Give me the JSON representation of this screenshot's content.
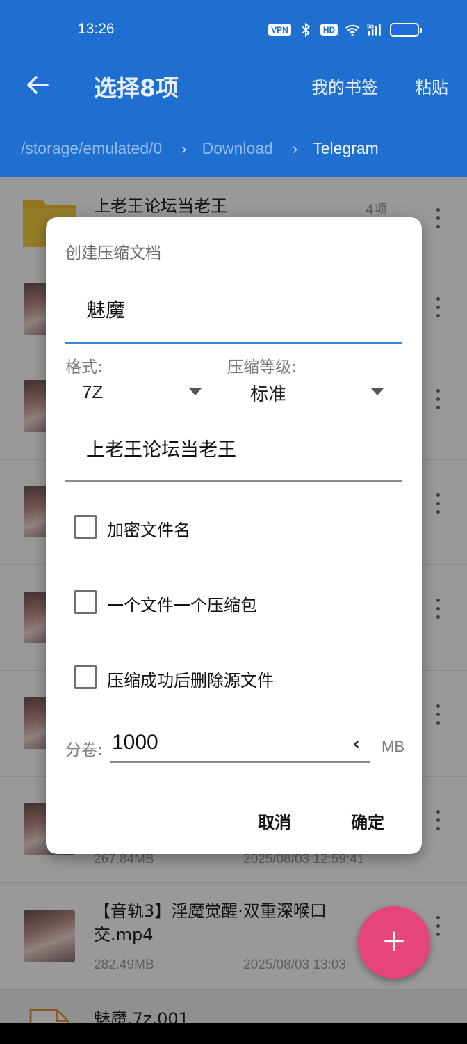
{
  "status": {
    "time": "13:26",
    "badges": [
      "VPN",
      "HD"
    ],
    "icons": [
      "bluetooth-icon",
      "wifi-icon",
      "signal-5g-icon",
      "battery-icon",
      "charging-icon"
    ],
    "network": "5G"
  },
  "appbar": {
    "title": "选择8项",
    "actions": [
      "我的书签",
      "粘贴"
    ],
    "breadcrumbs": [
      "/storage/emulated/0",
      "Download",
      "Telegram"
    ]
  },
  "files": [
    {
      "name": "上老王论坛当老王",
      "count": "4项",
      "type": "folder"
    },
    {
      "type": "video"
    },
    {
      "type": "video"
    },
    {
      "type": "video"
    },
    {
      "type": "video"
    },
    {
      "type": "video"
    },
    {
      "type": "video",
      "size": "267.84MB",
      "date": "2025/08/03 12:59:41"
    },
    {
      "name": "【音轨3】淫魔觉醒·双重深喉口交.mp4",
      "size": "282.49MB",
      "date": "2025/08/03 13:03",
      "type": "video"
    },
    {
      "name": "魅魔.7z.001",
      "type": "document"
    }
  ],
  "dialog": {
    "title": "创建压缩文档",
    "name_value": "魅魔",
    "format_label": "格式:",
    "format_value": "7Z",
    "level_label": "压缩等级:",
    "level_value": "标准",
    "folder_value": "上老王论坛当老王",
    "options": [
      {
        "label": "加密文件名",
        "checked": false
      },
      {
        "label": "一个文件一个压缩包",
        "checked": false
      },
      {
        "label": "压缩成功后删除源文件",
        "checked": false
      }
    ],
    "volume_label": "分卷:",
    "volume_value": "1000",
    "volume_unit": "MB",
    "cancel": "取消",
    "confirm": "确定"
  },
  "fab": {
    "label": "+"
  },
  "colors": {
    "primary": "#1e6fd0",
    "accent": "#e5457a",
    "focus_line": "#3b8ad6"
  }
}
